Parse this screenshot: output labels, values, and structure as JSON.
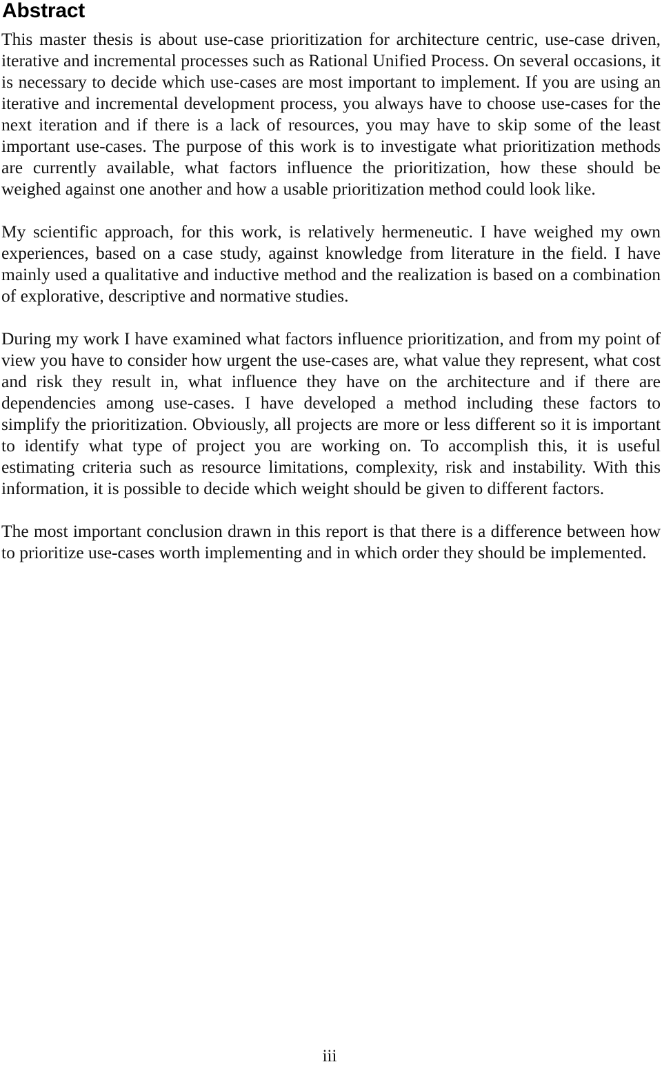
{
  "document": {
    "heading": "Abstract",
    "page_number": "iii",
    "paragraphs": [
      "This master thesis is about use-case prioritization for architecture centric, use-case driven, iterative and incremental processes such as Rational Unified Process. On several occasions, it is necessary to decide which use-cases are most important to implement. If you are using an iterative and incremental development process, you always have to choose use-cases for the next iteration and if there is a lack of resources, you may have to skip some of the least important use-cases. The purpose of this work is to investigate what prioritization methods are currently available, what factors influence the prioritization, how these should be weighed against one another and how a usable prioritization method could look like.",
      "My scientific approach, for this work, is relatively hermeneutic. I have weighed my own experiences, based on a case study, against knowledge from literature in the field. I have mainly used a qualitative and inductive method and the realization is based on a combination of explorative, descriptive and normative studies.",
      "During my work I have examined what factors influence prioritization, and from my point of view you have to consider how urgent the use-cases are, what value they represent, what cost and risk they result in, what influence they have on the architecture and if there are dependencies among use-cases. I have developed a method including these factors to simplify the prioritization. Obviously, all projects are more or less different so it is important to identify what type of project you are working on. To accomplish this, it is useful estimating criteria such as resource limitations, complexity, risk and instability. With this information, it is possible to decide which weight should be given to different factors.",
      "The most important conclusion drawn in this report is that there is a difference between how to prioritize use-cases worth implementing and in which order they should be implemented."
    ]
  },
  "colors": {
    "page_background": "#ffffff",
    "text": "#111111",
    "heading": "#000000"
  }
}
